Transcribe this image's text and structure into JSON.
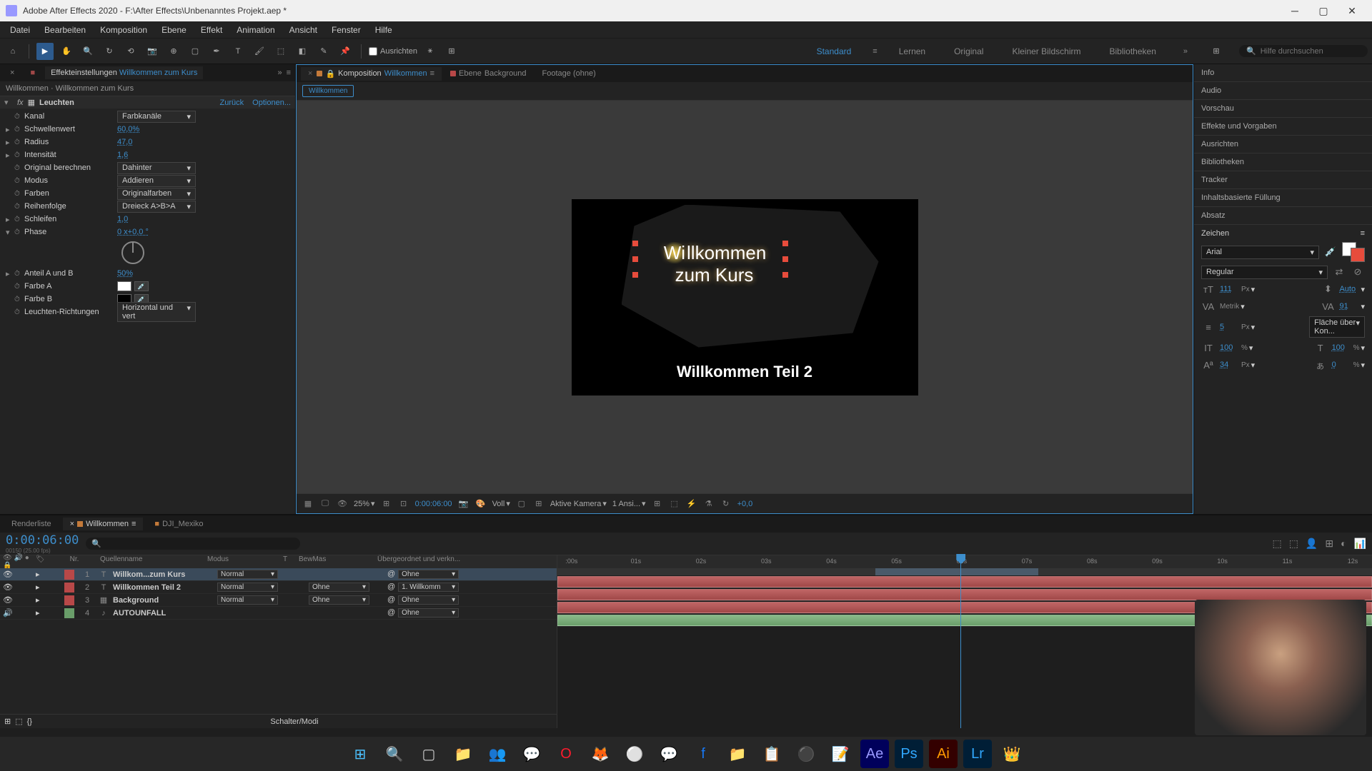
{
  "titlebar": {
    "text": "Adobe After Effects 2020 - F:\\After Effects\\Unbenanntes Projekt.aep *"
  },
  "menubar": [
    "Datei",
    "Bearbeiten",
    "Komposition",
    "Ebene",
    "Effekt",
    "Animation",
    "Ansicht",
    "Fenster",
    "Hilfe"
  ],
  "toolbar": {
    "snap_label": "Ausrichten",
    "workspaces": [
      "Standard",
      "Lernen",
      "Original",
      "Kleiner Bildschirm",
      "Bibliotheken"
    ],
    "active_workspace": "Standard",
    "search_placeholder": "Hilfe durchsuchen"
  },
  "effects_panel": {
    "tab_label": "Effekteinstellungen",
    "layer_name": "Willkommen zum Kurs",
    "breadcrumb": "Willkommen · Willkommen zum Kurs",
    "effect_name": "Leuchten",
    "link_reset": "Zurück",
    "link_options": "Optionen...",
    "props": {
      "kanal": {
        "label": "Kanal",
        "value": "Farbkanäle"
      },
      "schwellenwert": {
        "label": "Schwellenwert",
        "value": "60,0%"
      },
      "radius": {
        "label": "Radius",
        "value": "47,0"
      },
      "intensitat": {
        "label": "Intensität",
        "value": "1,6"
      },
      "original": {
        "label": "Original berechnen",
        "value": "Dahinter"
      },
      "modus": {
        "label": "Modus",
        "value": "Addieren"
      },
      "farben": {
        "label": "Farben",
        "value": "Originalfarben"
      },
      "reihenfolge": {
        "label": "Reihenfolge",
        "value": "Dreieck A>B>A"
      },
      "schleifen": {
        "label": "Schleifen",
        "value": "1,0"
      },
      "phase": {
        "label": "Phase",
        "value": "0 x+0,0 °"
      },
      "anteil": {
        "label": "Anteil A und B",
        "value": "50%"
      },
      "farbe_a": {
        "label": "Farbe A"
      },
      "farbe_b": {
        "label": "Farbe B"
      },
      "richtungen": {
        "label": "Leuchten-Richtungen",
        "value": "Horizontal und vert"
      }
    }
  },
  "comp_panel": {
    "tab_comp_label": "Komposition",
    "tab_comp_name": "Willkommen",
    "tab_layer_label": "Ebene",
    "tab_layer_name": "Background",
    "tab_footage": "Footage (ohne)",
    "flow_item": "Willkommen",
    "text_line1": "Willkommen",
    "text_line2": "zum Kurs",
    "text2": "Willkommen Teil 2",
    "footer": {
      "zoom": "25%",
      "res": "Voll",
      "camera": "Aktive Kamera",
      "views": "1 Ansi...",
      "timecode": "0:00:06:00",
      "exposure": "+0,0"
    }
  },
  "right_panel": {
    "sections": [
      "Info",
      "Audio",
      "Vorschau",
      "Effekte und Vorgaben",
      "Ausrichten",
      "Bibliotheken",
      "Tracker",
      "Inhaltsbasierte Füllung",
      "Absatz"
    ],
    "char_title": "Zeichen",
    "font": "Arial",
    "weight": "Regular",
    "size": "111",
    "size_unit": "Px",
    "leading": "Auto",
    "kerning": "Metrik",
    "tracking": "91",
    "stroke": "5",
    "stroke_unit": "Px",
    "stroke_opt": "Fläche über Kon...",
    "vscale": "100",
    "hscale": "100",
    "baseline": "34",
    "baseline_unit": "Px",
    "tsume": "0"
  },
  "timeline": {
    "tab_render": "Renderliste",
    "tab_comp": "Willkommen",
    "tab_dji": "DJI_Mexiko",
    "timecode": "0:00:06:00",
    "fps_hint": "00150 (25.00 fps)",
    "col_nr": "Nr.",
    "col_name": "Quellenname",
    "col_mode": "Modus",
    "col_t": "T",
    "col_bewmas": "BewMas",
    "col_parent": "Übergeordnet und verkn...",
    "layers": [
      {
        "num": "1",
        "name": "Willkom...zum Kurs",
        "mode": "Normal",
        "bewmas": "",
        "parent": "Ohne",
        "type": "T",
        "color": "red"
      },
      {
        "num": "2",
        "name": "Willkommen Teil 2",
        "mode": "Normal",
        "bewmas": "Ohne",
        "parent": "1. Willkomm",
        "type": "T",
        "color": "red"
      },
      {
        "num": "3",
        "name": "Background",
        "mode": "Normal",
        "bewmas": "Ohne",
        "parent": "Ohne",
        "type": "",
        "color": "red"
      },
      {
        "num": "4",
        "name": "AUTOUNFALL",
        "mode": "",
        "bewmas": "",
        "parent": "Ohne",
        "type": "",
        "color": "green"
      }
    ],
    "ticks": [
      ":00s",
      "01s",
      "02s",
      "03s",
      "04s",
      "05s",
      "06s",
      "07s",
      "08s",
      "09s",
      "10s",
      "11s",
      "12s"
    ],
    "toggle_label": "Schalter/Modi"
  }
}
